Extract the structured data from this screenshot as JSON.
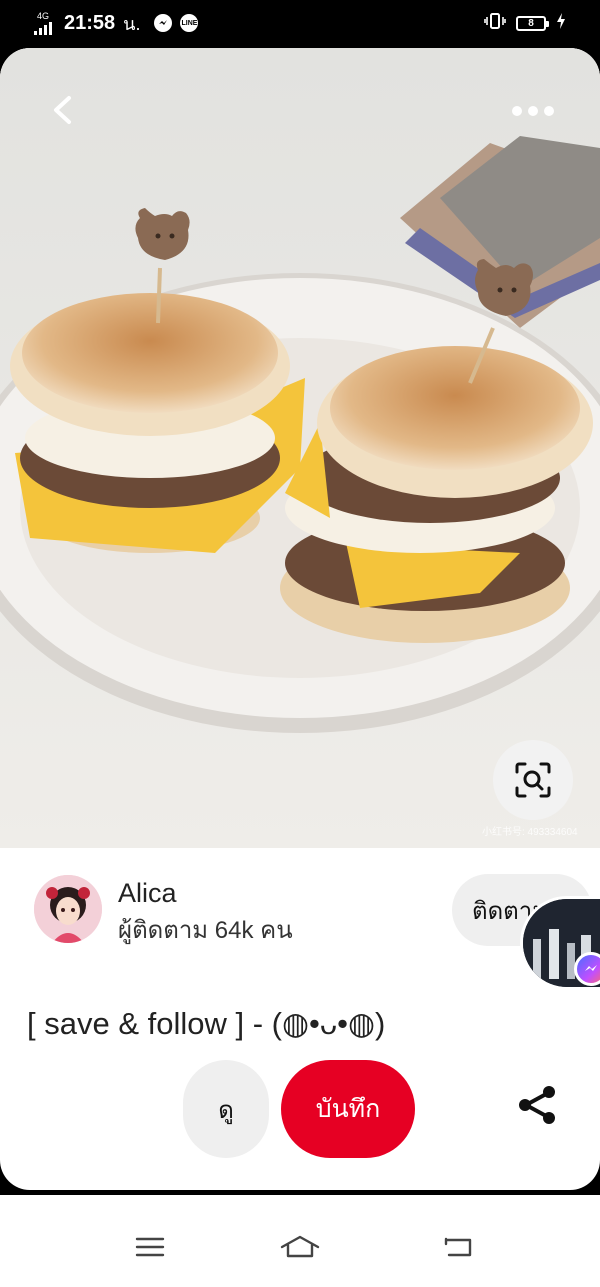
{
  "status_bar": {
    "network": "4G",
    "time": "21:58",
    "time_suffix": "น.",
    "messenger_icon": "messenger-icon",
    "line_icon": "line-icon",
    "line_label": "LINE",
    "battery_level": "8"
  },
  "pin": {
    "creator_name": "Alica",
    "followers_text": "ผู้ติดตาม 64k คน",
    "follow_label": "ติดตาม",
    "title": "[ save & follow ] - (◍•ᴗ•◍)",
    "view_label": "ดู",
    "save_label": "บันทึก",
    "watermark": "小红书号: 493334604"
  },
  "colors": {
    "save_red": "#e60023",
    "chip_gray": "#efefef",
    "background": "#000000"
  },
  "icons": [
    "back-arrow-icon",
    "more-dots-icon",
    "visual-search-icon",
    "share-icon",
    "menu-icon",
    "home-icon",
    "back-nav-icon"
  ]
}
